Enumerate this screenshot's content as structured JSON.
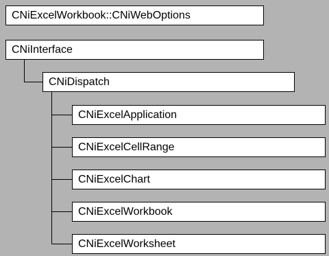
{
  "header": {
    "title": "CNiExcelWorkbook::CNiWebOptions"
  },
  "hierarchy": {
    "root": "CNiInterface",
    "child": "CNiDispatch",
    "leaves": [
      "CNiExcelApplication",
      "CNiExcelCellRange",
      "CNiExcelChart",
      "CNiExcelWorkbook",
      "CNiExcelWorksheet"
    ]
  },
  "colors": {
    "background": "#b3b3b3",
    "box": "#ffffff",
    "border": "#000000"
  }
}
